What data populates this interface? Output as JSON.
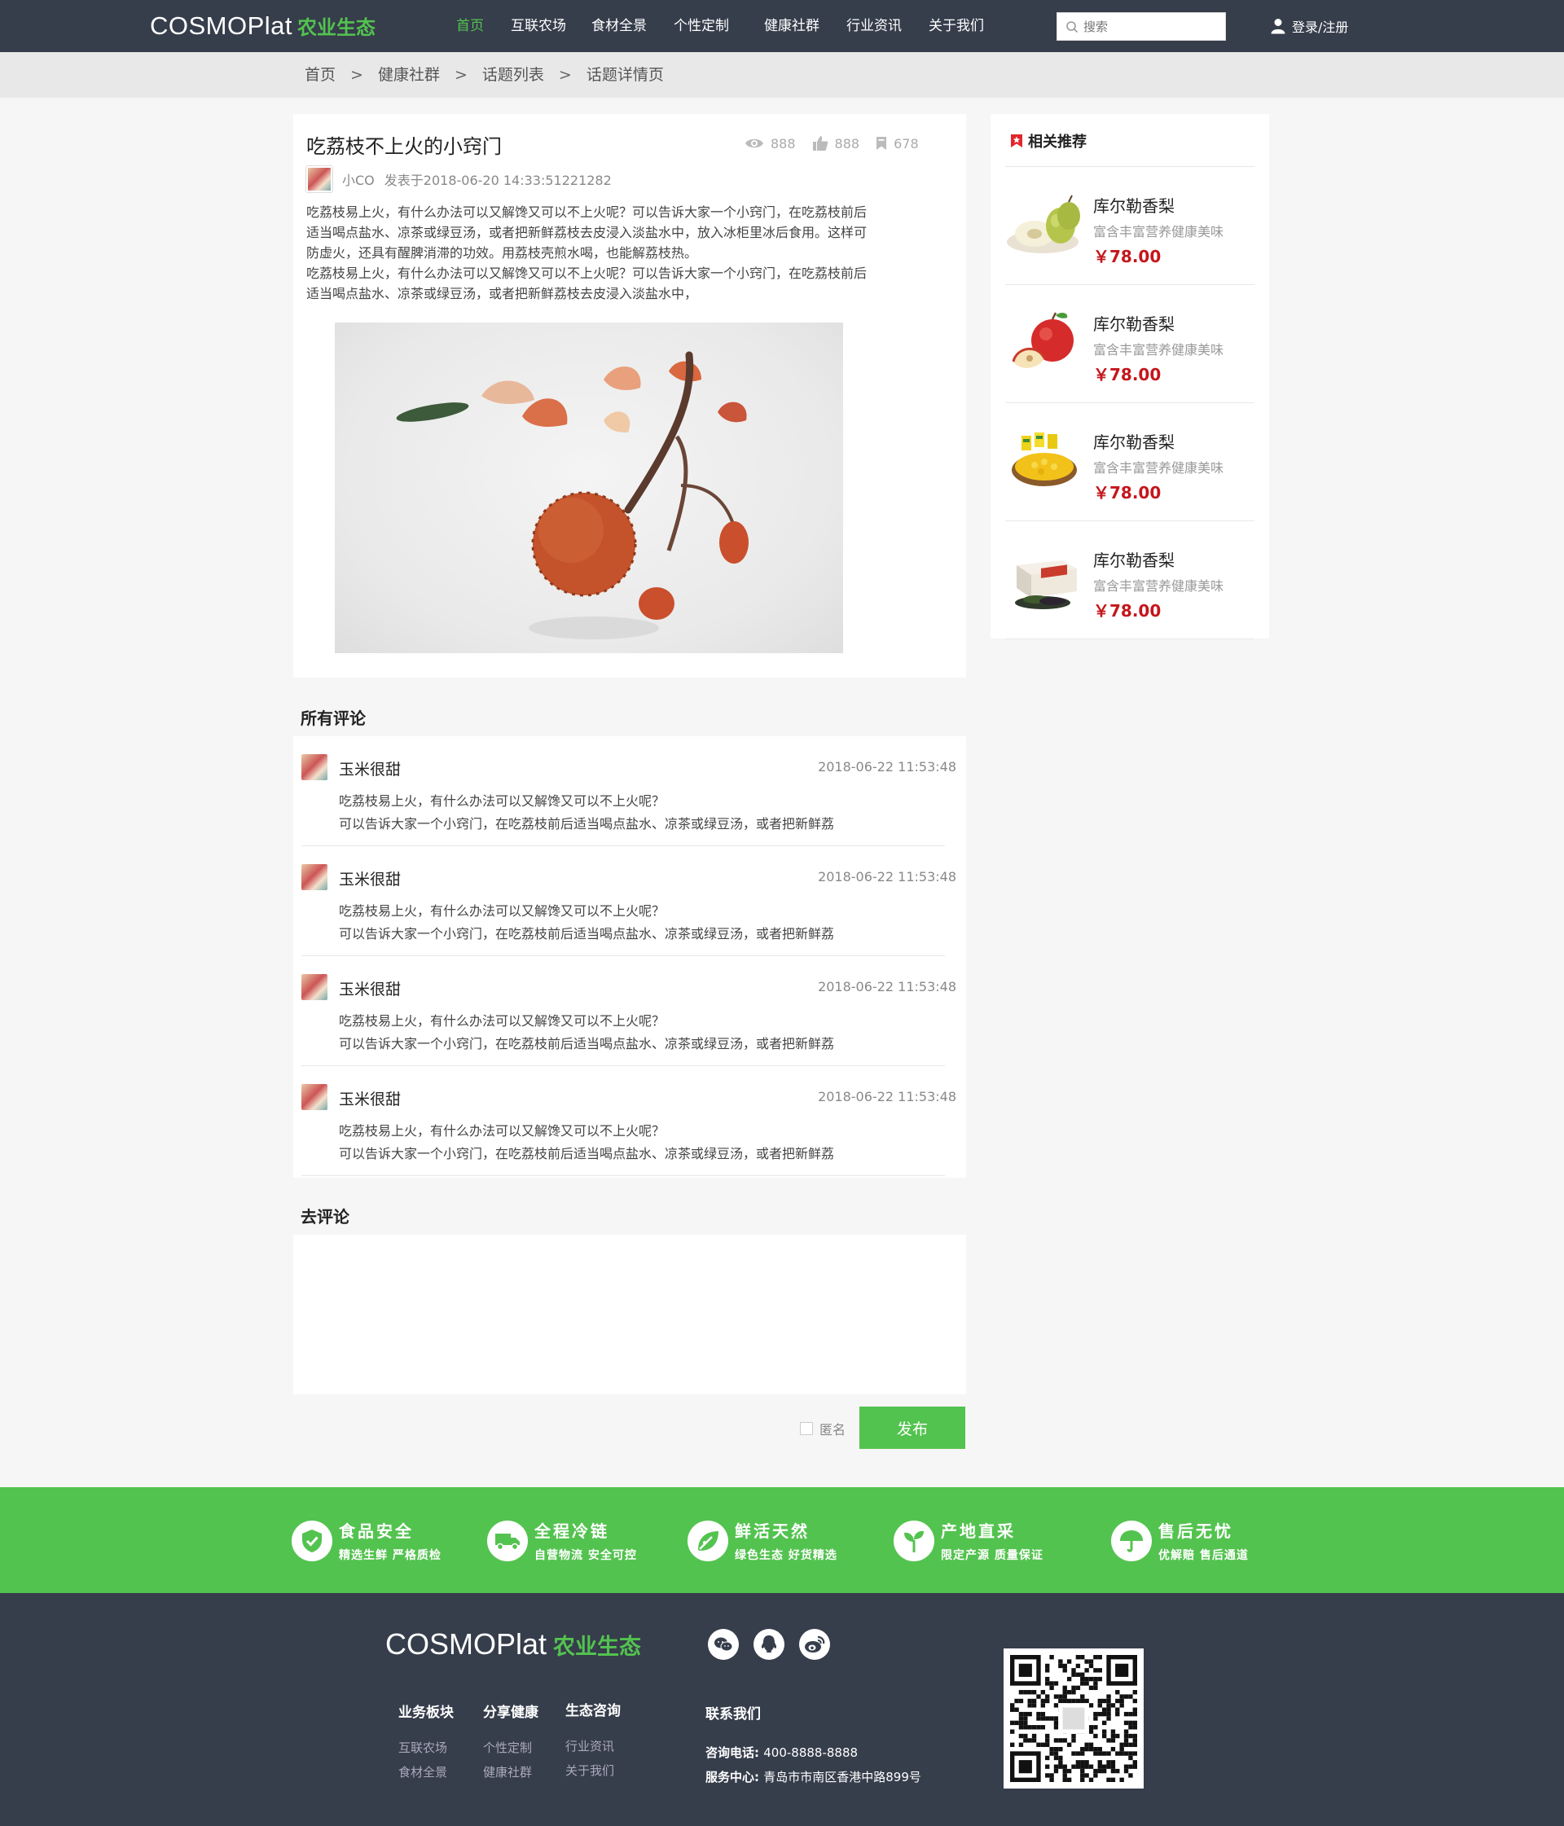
{
  "header": {
    "logo_brand": "COSMOPlat",
    "logo_eco": "农业生态",
    "nav": [
      {
        "label": "首页",
        "active": true
      },
      {
        "label": "互联农场",
        "active": false
      },
      {
        "label": "食材全景",
        "active": false
      },
      {
        "label": "个性定制",
        "active": false
      },
      {
        "label": "健康社群",
        "active": false
      },
      {
        "label": "行业资讯",
        "active": false
      },
      {
        "label": "关于我们",
        "active": false
      }
    ],
    "search_placeholder": "搜索",
    "login_label": "登录/注册"
  },
  "breadcrumb": [
    "首页",
    "健康社群",
    "话题列表",
    "话题详情页"
  ],
  "article": {
    "title": "吃荔枝不上火的小窍门",
    "views": "888",
    "likes": "888",
    "favorites": "678",
    "author": "小CO",
    "published": "发表于2018-06-20 14:33:51221282",
    "paragraphs": [
      "吃荔枝易上火，有什么办法可以又解馋又可以不上火呢？可以告诉大家一个小窍门，在吃荔枝前后",
      "适当喝点盐水、凉茶或绿豆汤，或者把新鲜荔枝去皮浸入淡盐水中，放入冰柜里冰后食用。这样可",
      "防虚火，还具有醒脾消滞的功效。用荔枝壳煎水喝，也能解荔枝热。",
      "吃荔枝易上火，有什么办法可以又解馋又可以不上火呢？可以告诉大家一个小窍门，在吃荔枝前后",
      "适当喝点盐水、凉茶或绿豆汤，或者把新鲜荔枝去皮浸入淡盐水中，"
    ]
  },
  "comments": {
    "title": "所有评论",
    "items": [
      {
        "name": "玉米很甜",
        "time": "2018-06-22 11:53:48",
        "line1": "吃荔枝易上火，有什么办法可以又解馋又可以不上火呢？",
        "line2": "可以告诉大家一个小窍门，在吃荔枝前后适当喝点盐水、凉茶或绿豆汤，或者把新鲜荔"
      },
      {
        "name": "玉米很甜",
        "time": "2018-06-22 11:53:48",
        "line1": "吃荔枝易上火，有什么办法可以又解馋又可以不上火呢？",
        "line2": "可以告诉大家一个小窍门，在吃荔枝前后适当喝点盐水、凉茶或绿豆汤，或者把新鲜荔"
      },
      {
        "name": "玉米很甜",
        "time": "2018-06-22 11:53:48",
        "line1": "吃荔枝易上火，有什么办法可以又解馋又可以不上火呢？",
        "line2": "可以告诉大家一个小窍门，在吃荔枝前后适当喝点盐水、凉茶或绿豆汤，或者把新鲜荔"
      },
      {
        "name": "玉米很甜",
        "time": "2018-06-22 11:53:48",
        "line1": "吃荔枝易上火，有什么办法可以又解馋又可以不上火呢？",
        "line2": "可以告诉大家一个小窍门，在吃荔枝前后适当喝点盐水、凉茶或绿豆汤，或者把新鲜荔"
      }
    ]
  },
  "post_comment": {
    "title": "去评论",
    "anonymous_label": "匿名",
    "publish_label": "发布"
  },
  "sidebar": {
    "title": "相关推荐",
    "products": [
      {
        "name": "库尔勒香梨",
        "desc": "富含丰富营养健康美味",
        "price": "￥78.00",
        "icon": "pear"
      },
      {
        "name": "库尔勒香梨",
        "desc": "富含丰富营养健康美味",
        "price": "￥78.00",
        "icon": "apple"
      },
      {
        "name": "库尔勒香梨",
        "desc": "富含丰富营养健康美味",
        "price": "￥78.00",
        "icon": "corn"
      },
      {
        "name": "库尔勒香梨",
        "desc": "富含丰富营养健康美味",
        "price": "￥78.00",
        "icon": "box"
      }
    ]
  },
  "features": [
    {
      "title": "食品安全",
      "sub": "精选生鲜 严格质检",
      "icon": "shield-check"
    },
    {
      "title": "全程冷链",
      "sub": "自营物流 安全可控",
      "icon": "truck"
    },
    {
      "title": "鲜活天然",
      "sub": "绿色生态 好货精选",
      "icon": "leaf"
    },
    {
      "title": "产地直采",
      "sub": "限定产源 质量保证",
      "icon": "sprout"
    },
    {
      "title": "售后无忧",
      "sub": "优解赔 售后通道",
      "icon": "umbrella"
    }
  ],
  "footer": {
    "logo_brand": "COSMOPlat",
    "logo_eco": "农业生态",
    "columns": [
      {
        "title": "业务板块",
        "links": [
          "互联农场",
          "食材全景"
        ]
      },
      {
        "title": "分享健康",
        "links": [
          "个性定制",
          "健康社群"
        ]
      },
      {
        "title": "生态咨询",
        "links": [
          "行业资讯",
          "关于我们"
        ]
      }
    ],
    "contact_title": "联系我们",
    "phone_label": "咨询电话:",
    "phone": "400-8888-8888",
    "address_label": "服务中心:",
    "address": "青岛市市南区香港中路899号"
  },
  "colors": {
    "accent": "#53c34f",
    "nav_bg": "#363d4b",
    "price": "#c4161c"
  }
}
